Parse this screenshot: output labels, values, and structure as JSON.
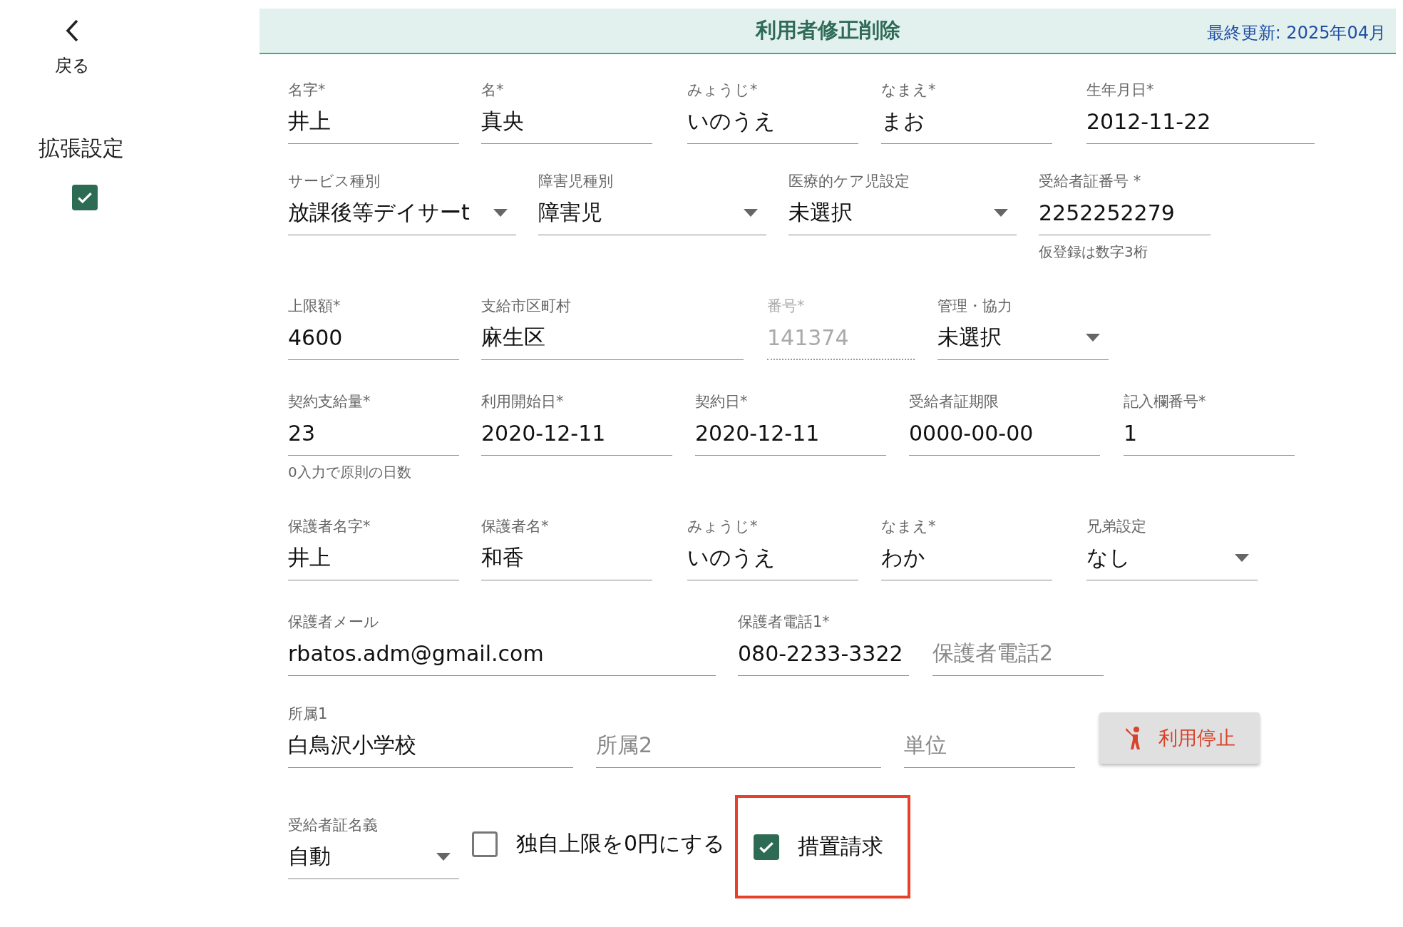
{
  "sidebar": {
    "back_label": "戻る",
    "extended_settings": {
      "label": "拡張設定",
      "checked": true
    }
  },
  "header": {
    "title": "利用者修正削除",
    "updated": "最終更新: 2025年04月"
  },
  "rows": [
    {
      "fields": [
        {
          "kind": "text",
          "label": "名字*",
          "value": "井上"
        },
        {
          "kind": "text",
          "label": "名*",
          "value": "真央"
        },
        {
          "kind": "text",
          "label": "みょうじ*",
          "value": "いのうえ"
        },
        {
          "kind": "text",
          "label": "なまえ*",
          "value": "まお"
        },
        {
          "kind": "text",
          "label": "生年月日*",
          "value": "2012-11-22"
        }
      ]
    },
    {
      "fields": [
        {
          "kind": "select",
          "label": "サービス種別",
          "value": "放課後等デイサーt"
        },
        {
          "kind": "select",
          "label": "障害児種別",
          "value": "障害児"
        },
        {
          "kind": "select",
          "label": "医療的ケア児設定",
          "value": "未選択"
        },
        {
          "kind": "text",
          "label": "受給者証番号 *",
          "value": "2252252279",
          "helper": "仮登録は数字3桁"
        }
      ]
    },
    {
      "fields": [
        {
          "kind": "text",
          "label": "上限額*",
          "value": "4600"
        },
        {
          "kind": "text",
          "label": "支給市区町村",
          "value": "麻生区"
        },
        {
          "kind": "disabled",
          "label": "番号*",
          "value": "141374"
        },
        {
          "kind": "select",
          "label": "管理・協力",
          "value": "未選択"
        }
      ]
    },
    {
      "fields": [
        {
          "kind": "text",
          "label": "契約支給量*",
          "value": "23",
          "helper": "0入力で原則の日数"
        },
        {
          "kind": "text",
          "label": "利用開始日*",
          "value": "2020-12-11"
        },
        {
          "kind": "text",
          "label": "契約日*",
          "value": "2020-12-11"
        },
        {
          "kind": "text",
          "label": "受給者証期限",
          "value": "0000-00-00"
        },
        {
          "kind": "text",
          "label": "記入欄番号*",
          "value": "1"
        }
      ]
    },
    {
      "fields": [
        {
          "kind": "text",
          "label": "保護者名字*",
          "value": "井上"
        },
        {
          "kind": "text",
          "label": "保護者名*",
          "value": "和香"
        },
        {
          "kind": "text",
          "label": "みょうじ*",
          "value": "いのうえ"
        },
        {
          "kind": "text",
          "label": "なまえ*",
          "value": "わか"
        },
        {
          "kind": "select",
          "label": "兄弟設定",
          "value": "なし"
        }
      ]
    },
    {
      "fields": [
        {
          "kind": "text",
          "label": "保護者メール",
          "value": "rbatos.adm@gmail.com"
        },
        {
          "kind": "text",
          "label": "保護者電話1*",
          "value": "080-2233-3322"
        },
        {
          "kind": "text",
          "placeholder": "保護者電話2"
        }
      ]
    },
    {
      "fields": [
        {
          "kind": "text",
          "label": "所属1",
          "value": "白鳥沢小学校"
        },
        {
          "kind": "text",
          "placeholder": "所属2"
        },
        {
          "kind": "text",
          "placeholder": "単位"
        },
        {
          "kind": "button",
          "text": "利用停止"
        }
      ]
    },
    {
      "fields": [
        {
          "kind": "select",
          "label": "受給者証名義",
          "value": "自動"
        },
        {
          "kind": "checkbox",
          "text": "独自上限を0円にする",
          "checked": false
        },
        {
          "kind": "checkbox",
          "text": "措置請求",
          "checked": true,
          "highlighted": true
        }
      ]
    }
  ]
}
